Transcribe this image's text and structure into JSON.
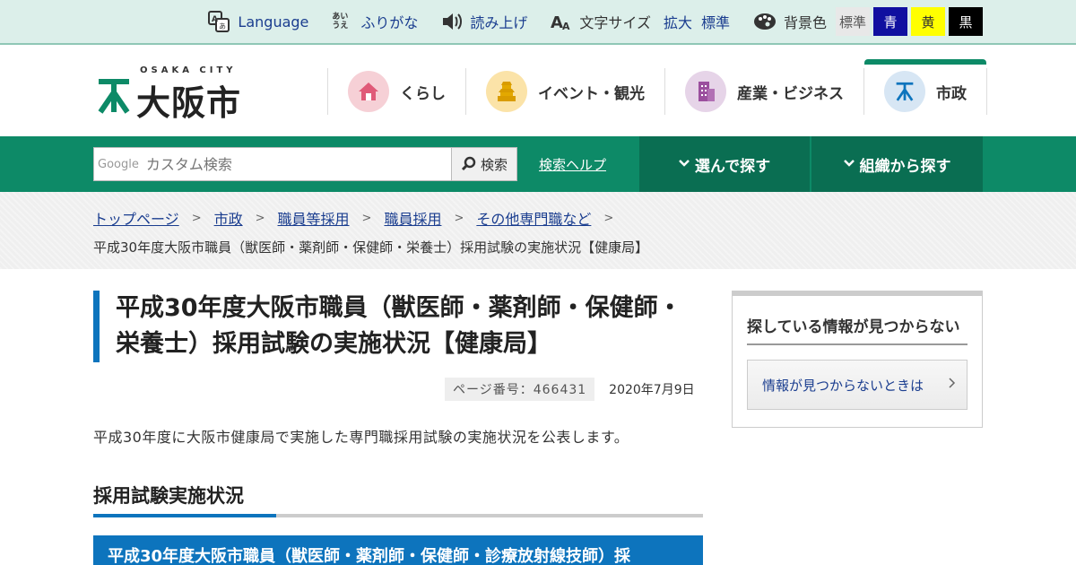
{
  "utility": {
    "language": "Language",
    "furigana": "ふりがな",
    "furigana_icon_text": "あいうえ",
    "read_aloud": "読み上げ",
    "font_size_label": "文字サイズ",
    "font_enlarge": "拡大",
    "font_standard": "標準",
    "bg_color_label": "背景色",
    "bg_standard": "標準",
    "bg_blue": "青",
    "bg_yellow": "黄",
    "bg_black": "黒",
    "colors": {
      "blue": "#1010a0",
      "yellow": "#ffff00",
      "black": "#000000"
    }
  },
  "logo": {
    "en": "OSAKA CITY",
    "jp": "大阪市"
  },
  "global_nav": [
    {
      "label": "くらし",
      "icon": "house-icon",
      "color": "#f6d0d6"
    },
    {
      "label": "イベント・観光",
      "icon": "castle-icon",
      "color": "#fbe3a8"
    },
    {
      "label": "産業・ビジネス",
      "icon": "building-icon",
      "color": "#e6d4e8"
    },
    {
      "label": "市政",
      "icon": "city-mark-icon",
      "color": "#d7e6f4"
    }
  ],
  "search": {
    "google_label": "Google",
    "placeholder": "カスタム検索",
    "button": "検索",
    "help": "検索ヘルプ",
    "browse": "選んで探す",
    "by_org": "組織から探す"
  },
  "breadcrumb": {
    "items": [
      "トップページ",
      "市政",
      "職員等採用",
      "職員採用",
      "その他専門職など"
    ],
    "current": "平成30年度大阪市職員（獣医師・薬剤師・保健師・栄養士）採用試験の実施状況【健康局】"
  },
  "page": {
    "title": "平成30年度大阪市職員（獣医師・薬剤師・保健師・栄養士）採用試験の実施状況【健康局】",
    "page_number": "ページ番号：466431",
    "date": "2020年7月9日",
    "lead": "平成30年度に大阪市健康局で実施した専門職採用試験の実施状況を公表します。",
    "h2": "採用試験実施状況",
    "h3": "平成30年度大阪市職員（獣医師・薬剤師・保健師・診療放射線技師）採"
  },
  "side": {
    "heading": "探している情報が見つからない",
    "link": "情報が見つからないときは"
  },
  "theme": {
    "green": "#0d8a67",
    "dark_green": "#0a6e52",
    "blue": "#0d74bd",
    "link": "#1a3d8f"
  }
}
